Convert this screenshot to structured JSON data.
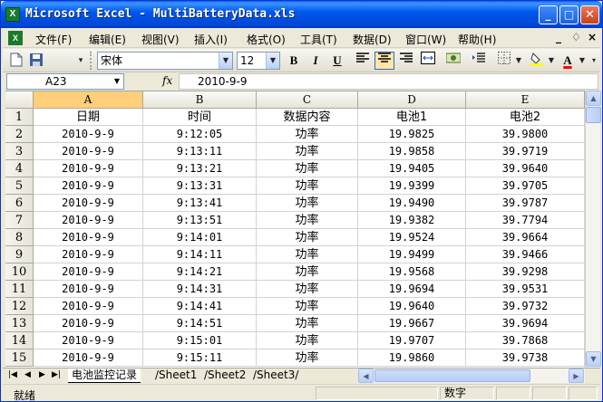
{
  "window": {
    "app_icon": "X",
    "title": "Microsoft Excel - MultiBatteryData.xls",
    "buttons": {
      "minimize": "_",
      "maximize": "□",
      "close": "✕"
    }
  },
  "menu": {
    "items": [
      "文件(F)",
      "编辑(E)",
      "视图(V)",
      "插入(I)",
      "格式(O)",
      "工具(T)",
      "数据(D)",
      "窗口(W)",
      "帮助(H)"
    ],
    "controls": [
      "_",
      "♢",
      "×"
    ]
  },
  "toolbar": {
    "font_name": "宋体",
    "font_size": "12",
    "bold": "B",
    "italic": "I",
    "underline": "U",
    "font_color_label": "A"
  },
  "formula_bar": {
    "name_box": "A23",
    "fx_label": "fx",
    "content": "2010-9-9"
  },
  "sheet": {
    "selected_column": "A",
    "columns": [
      "A",
      "B",
      "C",
      "D",
      "E"
    ],
    "row_numbers": [
      "1",
      "2",
      "3",
      "4",
      "5",
      "6",
      "7",
      "8",
      "9",
      "10",
      "11",
      "12",
      "13",
      "14",
      "15"
    ],
    "rows": [
      [
        "日期",
        "时间",
        "数据内容",
        "电池1",
        "电池2"
      ],
      [
        "2010-9-9",
        "9:12:05",
        "功率",
        "19.9825",
        "39.9800"
      ],
      [
        "2010-9-9",
        "9:13:11",
        "功率",
        "19.9858",
        "39.9719"
      ],
      [
        "2010-9-9",
        "9:13:21",
        "功率",
        "19.9405",
        "39.9640"
      ],
      [
        "2010-9-9",
        "9:13:31",
        "功率",
        "19.9399",
        "39.9705"
      ],
      [
        "2010-9-9",
        "9:13:41",
        "功率",
        "19.9490",
        "39.9787"
      ],
      [
        "2010-9-9",
        "9:13:51",
        "功率",
        "19.9382",
        "39.7794"
      ],
      [
        "2010-9-9",
        "9:14:01",
        "功率",
        "19.9524",
        "39.9664"
      ],
      [
        "2010-9-9",
        "9:14:11",
        "功率",
        "19.9499",
        "39.9466"
      ],
      [
        "2010-9-9",
        "9:14:21",
        "功率",
        "19.9568",
        "39.9298"
      ],
      [
        "2010-9-9",
        "9:14:31",
        "功率",
        "19.9694",
        "39.9531"
      ],
      [
        "2010-9-9",
        "9:14:41",
        "功率",
        "19.9640",
        "39.9732"
      ],
      [
        "2010-9-9",
        "9:14:51",
        "功率",
        "19.9667",
        "39.9694"
      ],
      [
        "2010-9-9",
        "9:15:01",
        "功率",
        "19.9707",
        "39.7868"
      ],
      [
        "2010-9-9",
        "9:15:11",
        "功率",
        "19.9860",
        "39.9738"
      ]
    ]
  },
  "sheet_tabs": [
    "电池监控记录",
    "Sheet1",
    "Sheet2",
    "Sheet3"
  ],
  "active_sheet": "电池监控记录",
  "status": {
    "left": "就绪",
    "mode": "数字"
  }
}
